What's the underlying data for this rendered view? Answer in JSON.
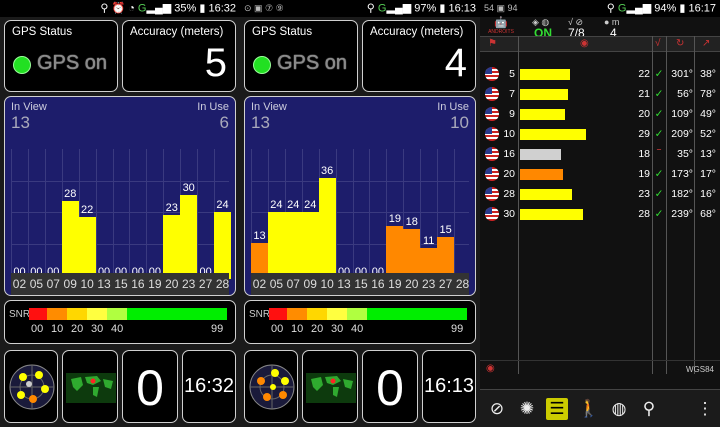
{
  "screens": [
    {
      "status": {
        "percent": "35%",
        "time": "16:32",
        "left_icons": "",
        "signal": "G"
      },
      "gps_status": {
        "title": "GPS Status",
        "value": "GPS on"
      },
      "accuracy": {
        "title": "Accuracy (meters)",
        "value": "5"
      },
      "chart_header": {
        "in_view_label": "In View",
        "in_view": "13",
        "in_use_label": "In Use",
        "in_use": "6"
      },
      "snr": {
        "label": "SNR",
        "ticks": [
          "00",
          "10",
          "20",
          "30",
          "40",
          "99"
        ]
      },
      "bottom": {
        "zero": "0",
        "clock": "16:32"
      }
    },
    {
      "status": {
        "percent": "97%",
        "time": "16:13",
        "left_icons": "⊙ ▣ ⑦ ⑨",
        "signal": "G"
      },
      "gps_status": {
        "title": "GPS Status",
        "value": "GPS on"
      },
      "accuracy": {
        "title": "Accuracy (meters)",
        "value": "4"
      },
      "chart_header": {
        "in_view_label": "In View",
        "in_view": "13",
        "in_use_label": "In Use",
        "in_use": "10"
      },
      "snr": {
        "label": "SNR",
        "ticks": [
          "00",
          "10",
          "20",
          "30",
          "40",
          "99"
        ]
      },
      "bottom": {
        "zero": "0",
        "clock": "16:13"
      }
    }
  ],
  "chart_data": [
    {
      "type": "bar",
      "categories": [
        "02",
        "05",
        "07",
        "09",
        "10",
        "13",
        "15",
        "16",
        "19",
        "20",
        "23",
        "27",
        "28"
      ],
      "values": [
        0,
        0,
        0,
        28,
        22,
        0,
        0,
        0,
        0,
        23,
        30,
        0,
        24
      ],
      "bar_colors": [
        "#ffff00",
        "#ffff00",
        "#ffff00",
        "#ffff00",
        "#ffff00",
        "#ffff00",
        "#ffff00",
        "#ffff00",
        "#ffff00",
        "#ffff00",
        "#ffff00",
        "#ffff00",
        "#ffff00"
      ],
      "in_use": [
        false,
        false,
        false,
        true,
        true,
        false,
        false,
        false,
        false,
        true,
        true,
        false,
        true
      ],
      "ylim": [
        0,
        40
      ]
    },
    {
      "type": "bar",
      "categories": [
        "02",
        "05",
        "07",
        "09",
        "10",
        "13",
        "15",
        "16",
        "19",
        "20",
        "23",
        "27",
        "28"
      ],
      "values": [
        13,
        24,
        24,
        24,
        36,
        0,
        0,
        0,
        19,
        18,
        11,
        15,
        0
      ],
      "value_labels": [
        "13",
        "24",
        "24",
        "24",
        "36",
        "00",
        "00",
        "00",
        "19",
        "18",
        "11",
        "15",
        ""
      ],
      "order": [
        "02",
        "05",
        "07",
        "09",
        "10",
        "13",
        "15",
        "16",
        "19",
        "20",
        "23",
        "27",
        "28"
      ],
      "bar_colors": [
        "#ff8800",
        "#ffff00",
        "#ffff00",
        "#ffff00",
        "#ffff00",
        "#ffff00",
        "#ffff00",
        "#ffff00",
        "#ff8800",
        "#ff8800",
        "#ff8800",
        "#ff8800",
        "#ff8800"
      ],
      "ylim": [
        0,
        40
      ]
    }
  ],
  "right": {
    "status": {
      "percent": "94%",
      "time": "16:17",
      "left_icons": "54 ▣ 94"
    },
    "header": {
      "on": "ON",
      "fix": "7/8",
      "count": "4",
      "logo": "ANDROITS"
    },
    "table": [
      {
        "prn": "5",
        "snr": 22,
        "snr_label": "22",
        "used": "✓",
        "azimuth": "301°",
        "elevation": "38°",
        "color": "#ffff00"
      },
      {
        "prn": "7",
        "snr": 21,
        "snr_label": "21",
        "used": "✓",
        "azimuth": "56°",
        "elevation": "78°",
        "color": "#ffff00"
      },
      {
        "prn": "9",
        "snr": 20,
        "snr_label": "20",
        "used": "✓",
        "azimuth": "109°",
        "elevation": "49°",
        "color": "#ffff00"
      },
      {
        "prn": "10",
        "snr": 29,
        "snr_label": "29",
        "used": "✓",
        "azimuth": "209°",
        "elevation": "52°",
        "color": "#ffff00"
      },
      {
        "prn": "16",
        "snr": 18,
        "snr_label": "18",
        "used": "‾",
        "azimuth": "35°",
        "elevation": "13°",
        "color": "#d0d0d0"
      },
      {
        "prn": "20",
        "snr": 19,
        "snr_label": "19",
        "used": "✓",
        "azimuth": "173°",
        "elevation": "17°",
        "color": "#ff8800"
      },
      {
        "prn": "28",
        "snr": 23,
        "snr_label": "23",
        "used": "✓",
        "azimuth": "182°",
        "elevation": "16°",
        "color": "#ffff00"
      },
      {
        "prn": "30",
        "snr": 28,
        "snr_label": "28",
        "used": "✓",
        "azimuth": "239°",
        "elevation": "68°",
        "color": "#ffff00"
      }
    ],
    "footer_label": "WGS84",
    "nav_icons": [
      "compass-icon",
      "radar-icon",
      "bars-icon",
      "walk-icon",
      "globe-icon",
      "pin-icon",
      "menu-icon"
    ]
  }
}
